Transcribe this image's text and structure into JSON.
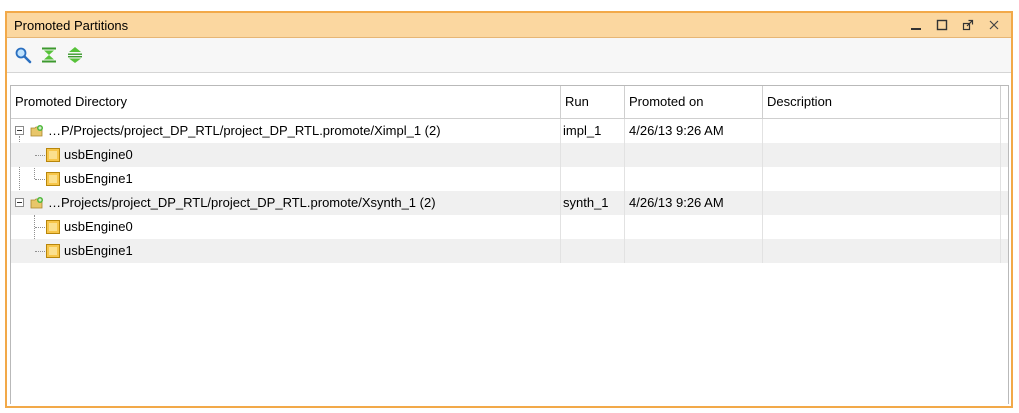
{
  "window": {
    "title": "Promoted Partitions",
    "controls": [
      "minimize-icon",
      "maximize-icon",
      "float-icon",
      "close-icon"
    ]
  },
  "toolbar": {
    "buttons": [
      "search-icon",
      "collapse-all-icon",
      "expand-all-icon"
    ]
  },
  "table": {
    "columns": [
      "Promoted Directory",
      "Run",
      "Promoted on",
      "Description"
    ],
    "groups": [
      {
        "directory": "…P/Projects/project_DP_RTL/project_DP_RTL.promote/Ximpl_1 (2)",
        "run": "impl_1",
        "promoted_on": "4/26/13 9:26 AM",
        "description": "",
        "children": [
          "usbEngine0",
          "usbEngine1"
        ]
      },
      {
        "directory": "…Projects/project_DP_RTL/project_DP_RTL.promote/Xsynth_1 (2)",
        "run": "synth_1",
        "promoted_on": "4/26/13 9:26 AM",
        "description": "",
        "children": [
          "usbEngine0",
          "usbEngine1"
        ]
      }
    ]
  },
  "colors": {
    "title_bar": "#fbd7a0",
    "window_border": "#f2a949",
    "alt_row": "#f0f0f0"
  }
}
